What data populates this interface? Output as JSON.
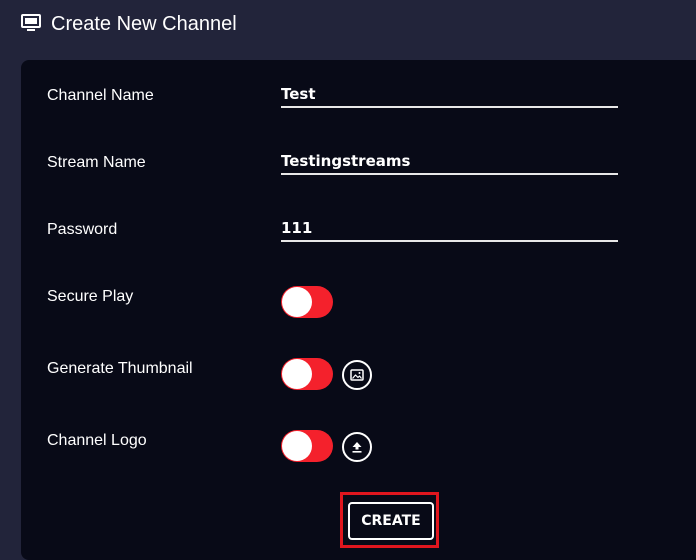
{
  "header": {
    "icon": "monitor-icon",
    "title": "Create New Channel"
  },
  "form": {
    "channel_name": {
      "label": "Channel Name",
      "value": "Test"
    },
    "stream_name": {
      "label": "Stream Name",
      "value": "Testingstreams"
    },
    "password": {
      "label": "Password",
      "value": "111"
    },
    "secure_play": {
      "label": "Secure Play",
      "enabled": false
    },
    "generate_thumbnail": {
      "label": "Generate Thumbnail",
      "enabled": false,
      "action_icon": "image-icon"
    },
    "channel_logo": {
      "label": "Channel Logo",
      "enabled": false,
      "action_icon": "upload-icon"
    }
  },
  "actions": {
    "create_label": "CREATE"
  },
  "colors": {
    "page_background": "#22243a",
    "panel_background": "#080a17",
    "toggle_off": "#f4212c",
    "highlight": "#e0161e",
    "text": "#ffffff"
  }
}
